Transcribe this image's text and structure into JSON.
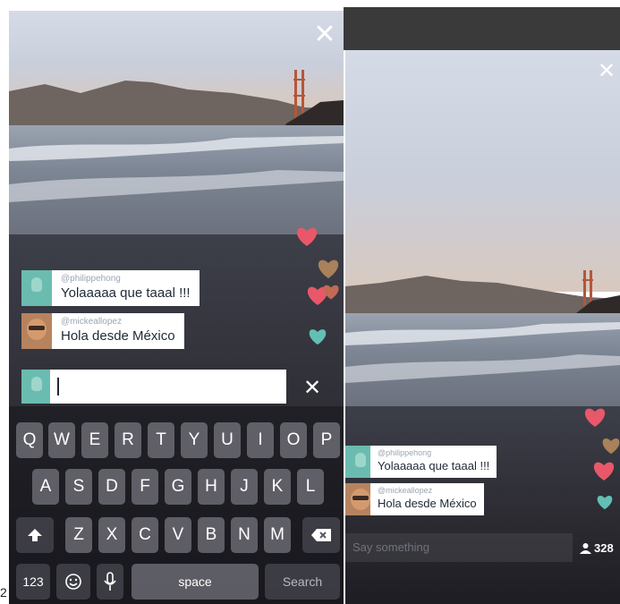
{
  "corner_label": "2",
  "left_phone": {
    "close_icon": "✕",
    "comments": [
      {
        "user": "@philippehong",
        "text": "Yolaaaaa que taaal !!!"
      },
      {
        "user": "@mickeallopez",
        "text": "Hola desde México"
      }
    ],
    "input": {
      "value": "",
      "clear_icon": "✕"
    },
    "keyboard": {
      "row1": [
        "Q",
        "W",
        "E",
        "R",
        "T",
        "Y",
        "U",
        "I",
        "O",
        "P"
      ],
      "row2": [
        "A",
        "S",
        "D",
        "F",
        "G",
        "H",
        "J",
        "K",
        "L"
      ],
      "row3": [
        "Z",
        "X",
        "C",
        "V",
        "B",
        "N",
        "M"
      ],
      "shift_icon": "shift-arrow-icon",
      "delete_icon": "backspace-icon",
      "numbers_label": "123",
      "emoji_icon": "emoji-icon",
      "mic_icon": "microphone-icon",
      "space_label": "space",
      "search_label": "Search"
    }
  },
  "right_phone": {
    "close_icon": "✕",
    "comments": [
      {
        "user": "@philippehong",
        "text": "Yolaaaaa que taaal !!!"
      },
      {
        "user": "@mickeallopez",
        "text": "Hola desde México"
      }
    ],
    "say_placeholder": "Say something",
    "viewer_count": "328"
  },
  "colors": {
    "heart_red": "#e8586a",
    "heart_brown": "#a9815a",
    "heart_teal": "#62bfb3",
    "avatar_teal": "#6bbcb0"
  }
}
